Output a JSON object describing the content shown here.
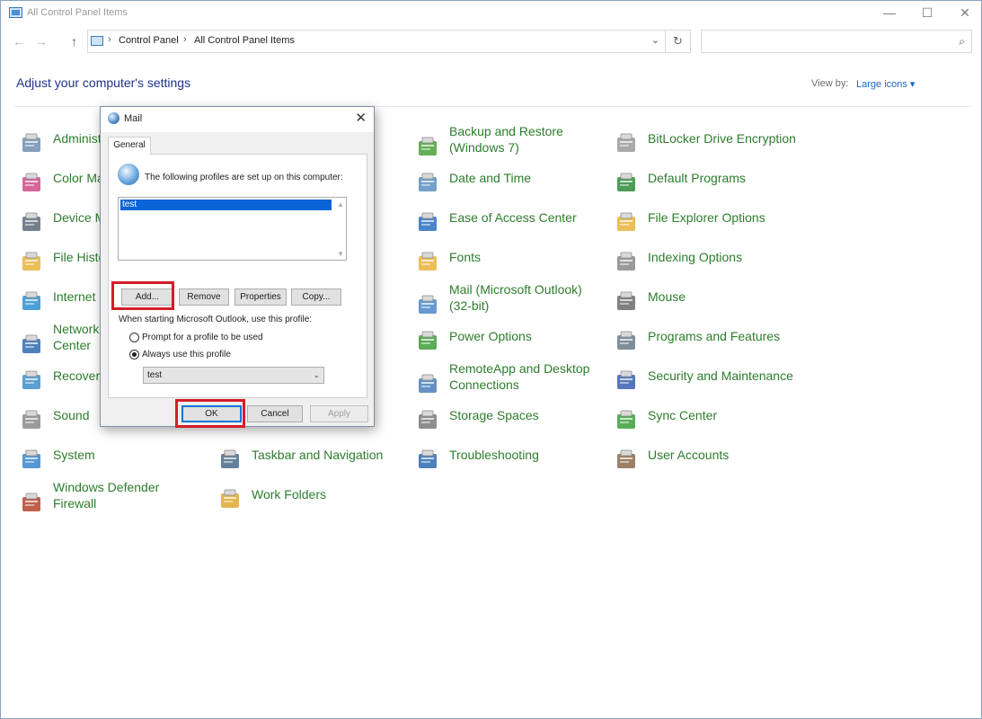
{
  "window": {
    "title": "All Control Panel Items",
    "controls": {
      "minimize": "—",
      "maximize": "☐",
      "close": "✕"
    }
  },
  "nav": {
    "back": "←",
    "forward": "→",
    "up": "↑"
  },
  "address": {
    "crumbs": [
      "Control Panel",
      "All Control Panel Items"
    ],
    "separator": "›",
    "dropdown": "⌄",
    "refresh": "↻"
  },
  "search": {
    "placeholder": "",
    "icon": "⌕"
  },
  "header": {
    "heading": "Adjust your computer's settings",
    "view_by_label": "View by:",
    "view_by_value": "Large icons ▾"
  },
  "items": [
    {
      "label": "Administrative Tools",
      "icon": "admin-tools-icon",
      "color": "#6f8fb0"
    },
    {
      "label": "Color Management",
      "icon": "color-management-icon",
      "color": "#d04a8a"
    },
    {
      "label": "Device Manager",
      "icon": "device-manager-icon",
      "color": "#5a6a7a"
    },
    {
      "label": "File History",
      "icon": "file-history-icon",
      "color": "#e7b43a"
    },
    {
      "label": "Internet Options",
      "icon": "internet-options-icon",
      "color": "#2e8fd0"
    },
    {
      "label": "Network and Sharing\nCenter",
      "icon": "network-icon",
      "color": "#2f6bb0"
    },
    {
      "label": "Recovery",
      "icon": "recovery-icon",
      "color": "#3d8fc8"
    },
    {
      "label": "Sound",
      "icon": "sound-icon",
      "color": "#8a8a8a"
    },
    {
      "label": "System",
      "icon": "system-icon",
      "color": "#3a86cc"
    },
    {
      "label": "Windows Defender\nFirewall",
      "icon": "firewall-icon",
      "color": "#b5442d"
    },
    {
      "label": "Taskbar and Navigation",
      "icon": "taskbar-icon",
      "color": "#4a6a8a"
    },
    {
      "label": "Work Folders",
      "icon": "work-folders-icon",
      "color": "#e0a834"
    },
    {
      "label": "Backup and Restore\n(Windows 7)",
      "icon": "backup-restore-icon",
      "color": "#4aa03a"
    },
    {
      "label": "Date and Time",
      "icon": "date-time-icon",
      "color": "#5a8ec0"
    },
    {
      "label": "Ease of Access Center",
      "icon": "ease-of-access-icon",
      "color": "#2a6fbf"
    },
    {
      "label": "Fonts",
      "icon": "fonts-icon",
      "color": "#e7b43a"
    },
    {
      "label": "Mail (Microsoft Outlook)\n(32-bit)",
      "icon": "mail-icon",
      "color": "#4a88c8"
    },
    {
      "label": "Power Options",
      "icon": "power-options-icon",
      "color": "#3e9e3a"
    },
    {
      "label": "RemoteApp and Desktop\nConnections",
      "icon": "remoteapp-icon",
      "color": "#4a7fb8"
    },
    {
      "label": "Storage Spaces",
      "icon": "storage-spaces-icon",
      "color": "#7a7a7a"
    },
    {
      "label": "Troubleshooting",
      "icon": "troubleshooting-icon",
      "color": "#2f6bb0"
    },
    {
      "label": "BitLocker Drive Encryption",
      "icon": "bitlocker-icon",
      "color": "#9a9a9a"
    },
    {
      "label": "Default Programs",
      "icon": "default-programs-icon",
      "color": "#2e8b3a"
    },
    {
      "label": "File Explorer Options",
      "icon": "file-explorer-options-icon",
      "color": "#e7b43a"
    },
    {
      "label": "Indexing Options",
      "icon": "indexing-options-icon",
      "color": "#8a8a8a"
    },
    {
      "label": "Mouse",
      "icon": "mouse-icon",
      "color": "#6a6a6a"
    },
    {
      "label": "Programs and Features",
      "icon": "programs-features-icon",
      "color": "#6a7a8a"
    },
    {
      "label": "Security and Maintenance",
      "icon": "security-maintenance-icon",
      "color": "#3a5fb0"
    },
    {
      "label": "Sync Center",
      "icon": "sync-center-icon",
      "color": "#3aa03a"
    },
    {
      "label": "User Accounts",
      "icon": "user-accounts-icon",
      "color": "#8a6a4a"
    }
  ],
  "dialog": {
    "title": "Mail",
    "close": "✕",
    "tab": "General",
    "intro": "The following profiles are set up on this computer:",
    "profiles": [
      "test"
    ],
    "scroll_up": "▲",
    "scroll_down": "▼",
    "buttons": {
      "add": "Add...",
      "remove": "Remove",
      "properties": "Properties",
      "copy": "Copy..."
    },
    "startup_label": "When starting Microsoft Outlook, use this profile:",
    "option_prompt": "Prompt for a profile to be used",
    "option_always": "Always use this profile",
    "selected_option": "always",
    "selected_profile": "test",
    "select_chevron": "⌄",
    "ok": "OK",
    "cancel": "Cancel",
    "apply": "Apply"
  },
  "colors": {
    "link": "#2c7d2c",
    "heading": "#1e3287",
    "highlight": "#d11f27",
    "selection": "#0a64d8"
  }
}
